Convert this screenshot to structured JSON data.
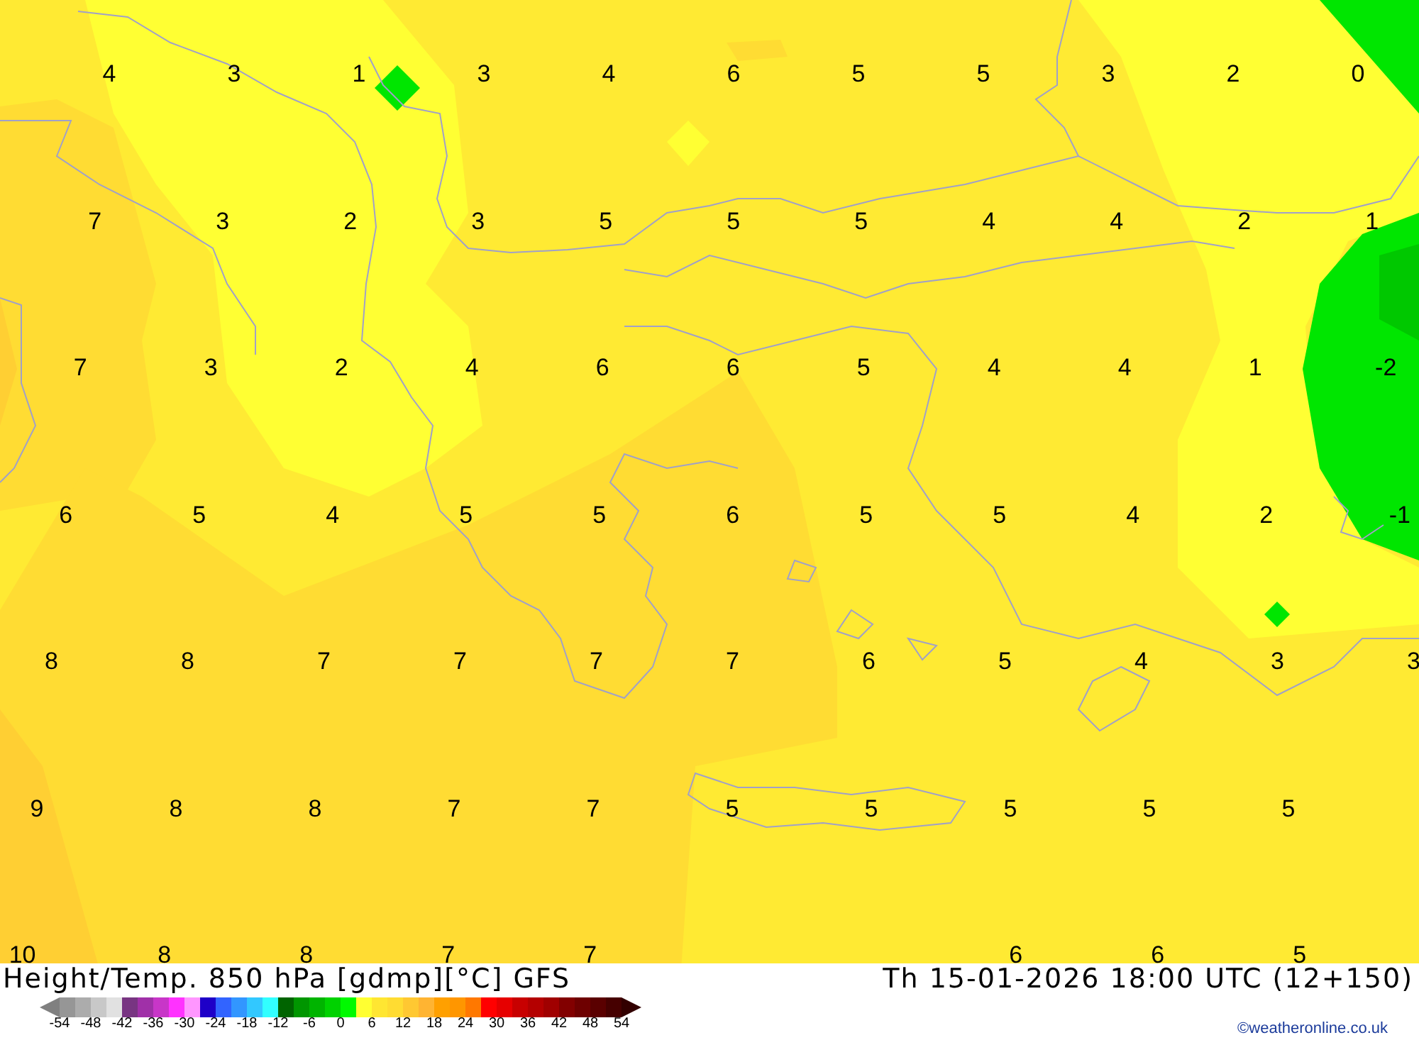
{
  "map": {
    "rows": [
      [
        "4",
        "3",
        "1",
        "3",
        "4",
        "6",
        "5",
        "5",
        "3",
        "2",
        "0"
      ],
      [
        "7",
        "3",
        "2",
        "3",
        "5",
        "5",
        "5",
        "4",
        "4",
        "2",
        "1"
      ],
      [
        "7",
        "3",
        "2",
        "4",
        "6",
        "6",
        "5",
        "4",
        "4",
        "1",
        "-2"
      ],
      [
        "6",
        "5",
        "4",
        "5",
        "5",
        "6",
        "5",
        "5",
        "4",
        "2",
        "-1"
      ],
      [
        "8",
        "8",
        "7",
        "7",
        "7",
        "7",
        "6",
        "5",
        "4",
        "3",
        "3"
      ],
      [
        "9",
        "8",
        "8",
        "7",
        "7",
        "5",
        "5",
        "5",
        "5",
        "5"
      ],
      [
        "10",
        "8",
        "8",
        "7",
        "7",
        null,
        null,
        "6",
        "6",
        "5"
      ]
    ]
  },
  "footer": {
    "title": "Height/Temp. 850 hPa [gdmp][°C] GFS",
    "valid_time": "Th 15-01-2026 18:00 UTC (12+150)",
    "copyright": "©weatheronline.co.uk"
  },
  "legend": {
    "swatches": [
      {
        "color": "#969696"
      },
      {
        "color": "#acacac"
      },
      {
        "color": "#c8c8c8"
      },
      {
        "color": "#e1e1e1"
      },
      {
        "color": "#783582"
      },
      {
        "color": "#a030a8"
      },
      {
        "color": "#c836c8"
      },
      {
        "color": "#ff32ff"
      },
      {
        "color": "#ff96ff"
      },
      {
        "color": "#1e00c8"
      },
      {
        "color": "#3264ff"
      },
      {
        "color": "#3296ff"
      },
      {
        "color": "#32c8ff"
      },
      {
        "color": "#32ffff"
      },
      {
        "color": "#006400"
      },
      {
        "color": "#009600"
      },
      {
        "color": "#00b400"
      },
      {
        "color": "#00d200"
      },
      {
        "color": "#00fa00"
      },
      {
        "color": "#ffff32"
      },
      {
        "color": "#ffe632"
      },
      {
        "color": "#ffdc32"
      },
      {
        "color": "#ffc832"
      },
      {
        "color": "#ffb432"
      },
      {
        "color": "#ffa000"
      },
      {
        "color": "#ff9600"
      },
      {
        "color": "#ff7800"
      },
      {
        "color": "#ff0000"
      },
      {
        "color": "#e60000"
      },
      {
        "color": "#c80000"
      },
      {
        "color": "#b40000"
      },
      {
        "color": "#a00000"
      },
      {
        "color": "#820000"
      },
      {
        "color": "#6e0000"
      },
      {
        "color": "#5a0000"
      },
      {
        "color": "#460000"
      }
    ],
    "labels": [
      "-54",
      "-48",
      "-42",
      "-36",
      "-30",
      "-24",
      "-18",
      "-12",
      "-6",
      "0",
      "6",
      "12",
      "18",
      "24",
      "30",
      "36",
      "42",
      "48",
      "54"
    ]
  }
}
